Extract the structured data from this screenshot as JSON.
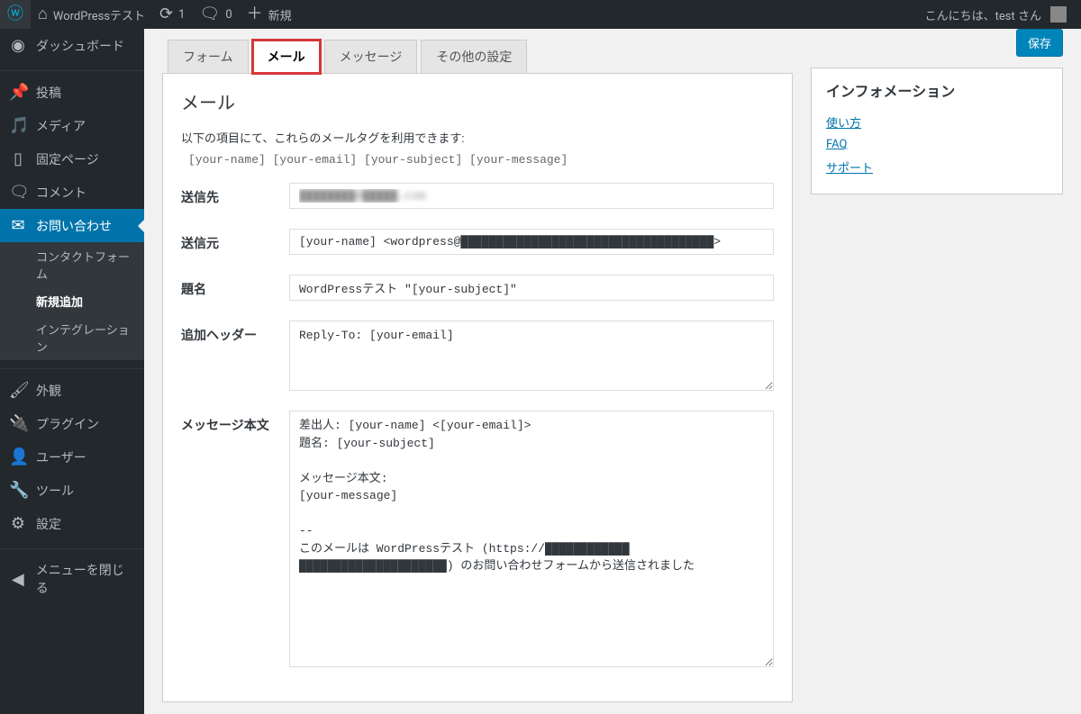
{
  "adminbar": {
    "site_title": "WordPressテスト",
    "updates": "1",
    "comments": "0",
    "new_label": "新規",
    "greeting": "こんにちは、test さん"
  },
  "sidebar": {
    "dashboard": "ダッシュボード",
    "posts": "投稿",
    "media": "メディア",
    "pages": "固定ページ",
    "comments": "コメント",
    "contact": "お問い合わせ",
    "contact_sub": {
      "forms": "コンタクトフォーム",
      "add_new": "新規追加",
      "integration": "インテグレーション"
    },
    "appearance": "外観",
    "plugins": "プラグイン",
    "users": "ユーザー",
    "tools": "ツール",
    "settings": "設定",
    "collapse": "メニューを閉じる"
  },
  "buttons": {
    "save": "保存"
  },
  "tabs": {
    "form": "フォーム",
    "mail": "メール",
    "messages": "メッセージ",
    "settings": "その他の設定"
  },
  "panel": {
    "title": "メール",
    "subtext": "以下の項目にて、これらのメールタグを利用できます:",
    "tags": "[your-name] [your-email] [your-subject] [your-message]",
    "to_label": "送信先",
    "to_value_masked": "████████@█████.com",
    "from_label": "送信元",
    "from_value": "[your-name] <wordpress@████████████████████████████████████>",
    "subject_label": "題名",
    "subject_value": "WordPressテスト \"[your-subject]\"",
    "headers_label": "追加ヘッダー",
    "headers_value": "Reply-To: [your-email]",
    "body_label": "メッセージ本文",
    "body_value": "差出人: [your-name] <[your-email]>\n題名: [your-subject]\n\nメッセージ本文:\n[your-message]\n\n-- \nこのメールは WordPressテスト (https://████████████\n█████████████████████) のお問い合わせフォームから送信されました"
  },
  "info": {
    "title": "インフォメーション",
    "usage": "使い方",
    "faq": "FAQ",
    "support": "サポート"
  }
}
